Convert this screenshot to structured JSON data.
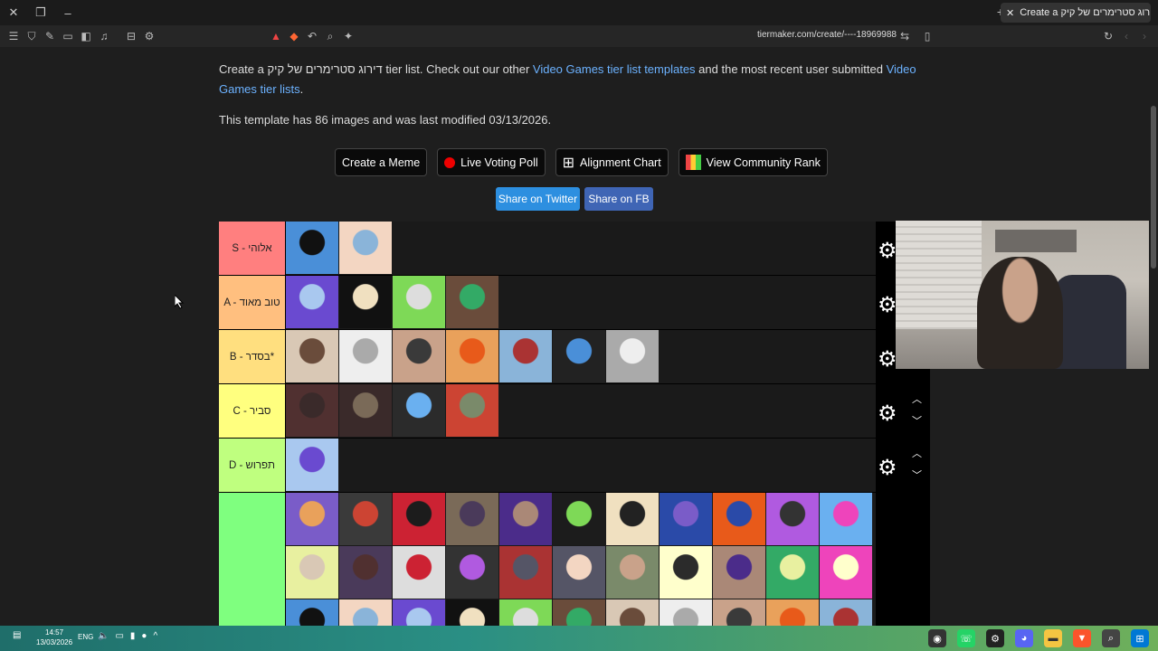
{
  "browser": {
    "tab_title": "Create a דירוג סטרימרים של קיק",
    "url": "tiermaker.com/create/----18969988"
  },
  "intro": {
    "text_before": "Create a דירוג סטרימרים של קיק tier list. Check out our other ",
    "link1": "Video Games tier list templates",
    "text_mid": " and the most recent user submitted ",
    "link2": "Video Games tier lists",
    "text_end": "."
  },
  "meta": "This template has 86 images and was last modified 03/13/2026.",
  "buttons": {
    "create_meme": "Create a Meme",
    "live_voting": "Live Voting Poll",
    "alignment_chart": "Alignment Chart",
    "community_rank": "View Community Rank",
    "share_twitter": "Share on Twitter",
    "share_fb": "Share on FB"
  },
  "tiers": [
    {
      "label": "S - אלוהי",
      "color": "#ff7f7f",
      "count": 2
    },
    {
      "label": "A - טוב מאוד",
      "color": "#ffbf7f",
      "count": 4
    },
    {
      "label": "B - בסדר*",
      "color": "#ffdf7f",
      "count": 7
    },
    {
      "label": "C - סביר",
      "color": "#ffff7f",
      "count": 4
    },
    {
      "label": "D - תפרוש",
      "color": "#bfff7f",
      "count": 1
    },
    {
      "label": "",
      "color": "#7fff7f",
      "count": 33
    }
  ],
  "taskbar": {
    "time": "14:57",
    "date": "13/03/2026",
    "lang": "ENG"
  }
}
